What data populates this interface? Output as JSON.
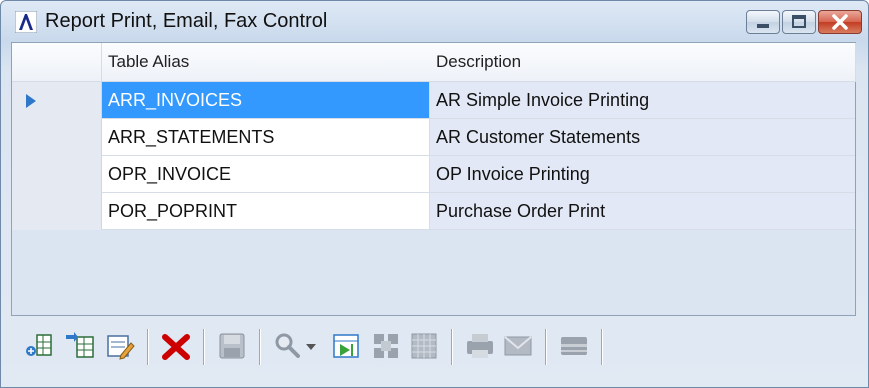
{
  "window": {
    "title": "Report Print, Email, Fax Control",
    "icon": "A-logo-icon",
    "controls": [
      "minimize-icon",
      "maximize-icon",
      "close-icon"
    ]
  },
  "grid": {
    "columns": [
      "Table Alias",
      "Description"
    ],
    "rows": [
      {
        "alias": "ARR_INVOICES",
        "description": "AR Simple Invoice Printing",
        "selected": true
      },
      {
        "alias": "ARR_STATEMENTS",
        "description": "AR Customer Statements",
        "selected": false
      },
      {
        "alias": "OPR_INVOICE",
        "description": "OP Invoice Printing",
        "selected": false
      },
      {
        "alias": "POR_POPRINT",
        "description": "Purchase Order Print",
        "selected": false
      }
    ]
  },
  "toolbar": {
    "buttons": [
      "add-record-icon",
      "insert-record-icon",
      "edit-record-icon",
      "delete-icon",
      "save-icon",
      "search-icon",
      "dropdown-arrow-icon",
      "go-to-icon",
      "grid-layout-icon",
      "table-view-icon",
      "print-icon",
      "email-icon",
      "fax-icon"
    ]
  },
  "colors": {
    "selection": "#3399ff",
    "delete": "#cc0000",
    "arrow": "#2f78c9"
  }
}
